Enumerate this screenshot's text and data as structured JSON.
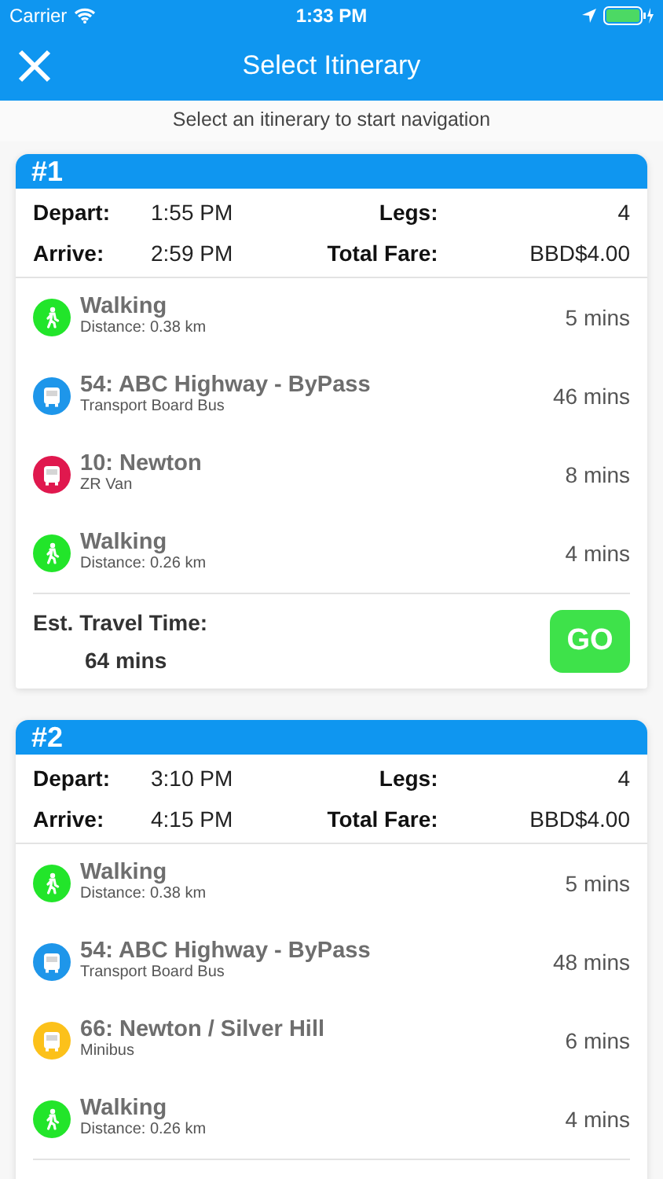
{
  "status_bar": {
    "carrier": "Carrier",
    "time": "1:33 PM"
  },
  "nav": {
    "title": "Select Itinerary"
  },
  "subtitle": "Select an itinerary to start navigation",
  "itineraries": [
    {
      "number": "#1",
      "depart_label": "Depart:",
      "depart": "1:55 PM",
      "legs_label": "Legs:",
      "legs": "4",
      "arrive_label": "Arrive:",
      "arrive": "2:59 PM",
      "fare_label": "Total Fare:",
      "fare": "BBD$4.00",
      "steps": [
        {
          "kind": "walk",
          "color": "#22e52a",
          "title": "Walking",
          "detail": "Distance: 0.38 km",
          "duration": "5 mins"
        },
        {
          "kind": "bus",
          "color": "#1e96ea",
          "title": "54: ABC Highway - ByPass",
          "detail": "Transport Board Bus",
          "duration": "46 mins"
        },
        {
          "kind": "bus",
          "color": "#e0184e",
          "title": "10: Newton",
          "detail": "ZR Van",
          "duration": "8 mins"
        },
        {
          "kind": "walk",
          "color": "#22e52a",
          "title": "Walking",
          "detail": "Distance: 0.26 km",
          "duration": "4 mins"
        }
      ],
      "travel_label": "Est. Travel Time:",
      "travel_time": "64 mins",
      "go": "GO"
    },
    {
      "number": "#2",
      "depart_label": "Depart:",
      "depart": "3:10 PM",
      "legs_label": "Legs:",
      "legs": "4",
      "arrive_label": "Arrive:",
      "arrive": "4:15 PM",
      "fare_label": "Total Fare:",
      "fare": "BBD$4.00",
      "steps": [
        {
          "kind": "walk",
          "color": "#22e52a",
          "title": "Walking",
          "detail": "Distance: 0.38 km",
          "duration": "5 mins"
        },
        {
          "kind": "bus",
          "color": "#1e96ea",
          "title": "54: ABC Highway - ByPass",
          "detail": "Transport Board Bus",
          "duration": "48 mins"
        },
        {
          "kind": "bus",
          "color": "#fcc11a",
          "title": "66: Newton / Silver Hill",
          "detail": "Minibus",
          "duration": "6 mins"
        },
        {
          "kind": "walk",
          "color": "#22e52a",
          "title": "Walking",
          "detail": "Distance: 0.26 km",
          "duration": "4 mins"
        }
      ]
    }
  ]
}
